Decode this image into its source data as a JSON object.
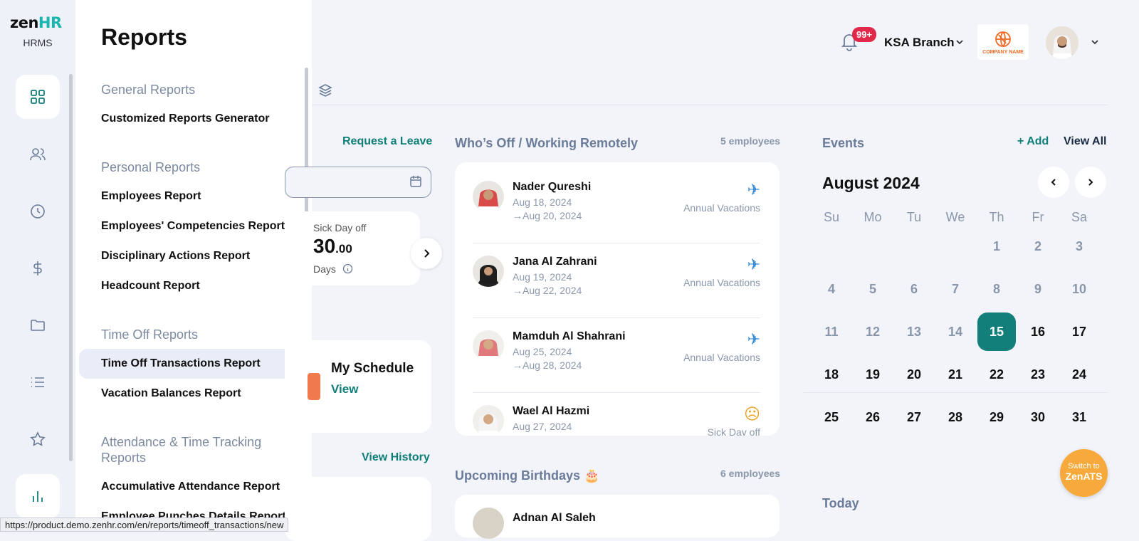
{
  "brand": {
    "logo_main": "zen",
    "logo_accent": "HR",
    "product": "HRMS"
  },
  "header": {
    "notification_badge": "99+",
    "branch": "KSA Branch",
    "company_logo_text": "COMPANY NAME"
  },
  "reports_menu": {
    "title": "Reports",
    "sections": [
      {
        "title": "General Reports",
        "items": [
          "Customized Reports Generator"
        ]
      },
      {
        "title": "Personal Reports",
        "items": [
          "Employees Report",
          "Employees' Competencies Report",
          "Disciplinary Actions Report",
          "Headcount Report"
        ]
      },
      {
        "title": "Time Off Reports",
        "items": [
          "Time Off Transactions Report",
          "Vacation Balances Report"
        ]
      },
      {
        "title": "Attendance & Time Tracking Reports",
        "items": [
          "Accumulative Attendance Report",
          "Employee Punches Details Report"
        ]
      }
    ]
  },
  "leave": {
    "request_link": "Request a Leave",
    "sick_label": "Sick Day off",
    "sick_value_int": "30",
    "sick_value_dec": ".00",
    "sick_unit": "Days"
  },
  "schedule": {
    "title": "My Schedule",
    "view": "View"
  },
  "history": {
    "view_history": "View History"
  },
  "whos_off": {
    "title": "Who’s Off / Working Remotely",
    "count": "5 employees",
    "people": [
      {
        "name": "Nader Qureshi",
        "from": "Aug 18, 2024",
        "to": "Aug 20, 2024",
        "type": "Annual Vacations"
      },
      {
        "name": "Jana Al Zahrani",
        "from": "Aug 19, 2024",
        "to": "Aug 22, 2024",
        "type": "Annual Vacations"
      },
      {
        "name": "Mamduh Al Shahrani",
        "from": "Aug 25, 2024",
        "to": "Aug 28, 2024",
        "type": "Annual Vacations"
      },
      {
        "name": "Wael Al Hazmi",
        "from": "Aug 27, 2024",
        "to": "",
        "type": "Sick Day off"
      }
    ]
  },
  "birthdays": {
    "title": "Upcoming Birthdays 🎂",
    "count": "6 employees",
    "people": [
      {
        "name": "Adnan Al Saleh"
      }
    ]
  },
  "events": {
    "title": "Events",
    "add": "+ Add",
    "view_all": "View All",
    "today": "Today"
  },
  "calendar": {
    "month": "August 2024",
    "weekdays": [
      "Su",
      "Mo",
      "Tu",
      "We",
      "Th",
      "Fr",
      "Sa"
    ],
    "today": 15,
    "weeks": [
      [
        "",
        "",
        "",
        "",
        "1",
        "2",
        "3"
      ],
      [
        "4",
        "5",
        "6",
        "7",
        "8",
        "9",
        "10"
      ],
      [
        "11",
        "12",
        "13",
        "14",
        "15",
        "16",
        "17"
      ],
      [
        "18",
        "19",
        "20",
        "21",
        "22",
        "23",
        "24"
      ],
      [
        "25",
        "26",
        "27",
        "28",
        "29",
        "30",
        "31"
      ]
    ]
  },
  "switch": {
    "line1": "Switch to",
    "line2": "ZenATS"
  },
  "status_url": "https://product.demo.zenhr.com/en/reports/timeoff_transactions/new",
  "colors": {
    "accent": "#127f7b",
    "badge": "#e0284a",
    "switch": "#f7a93b"
  }
}
